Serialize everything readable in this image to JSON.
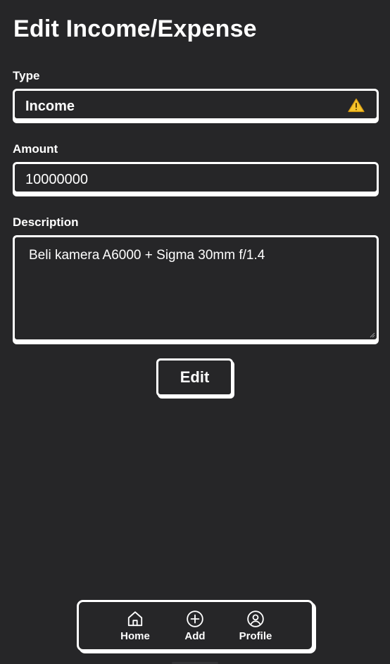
{
  "page": {
    "title": "Edit Income/Expense"
  },
  "form": {
    "type_label": "Type",
    "type_value": "Income",
    "amount_label": "Amount",
    "amount_value": "10000000",
    "description_label": "Description",
    "description_value": "Beli kamera A6000 + Sigma 30mm f/1.4",
    "submit_label": "Edit"
  },
  "nav": {
    "items": [
      {
        "label": "Home",
        "icon": "home-icon"
      },
      {
        "label": "Add",
        "icon": "plus-circle-icon"
      },
      {
        "label": "Profile",
        "icon": "user-circle-icon"
      }
    ]
  },
  "colors": {
    "background": "#262628",
    "foreground": "#ffffff",
    "warning": "#f5c42c"
  }
}
